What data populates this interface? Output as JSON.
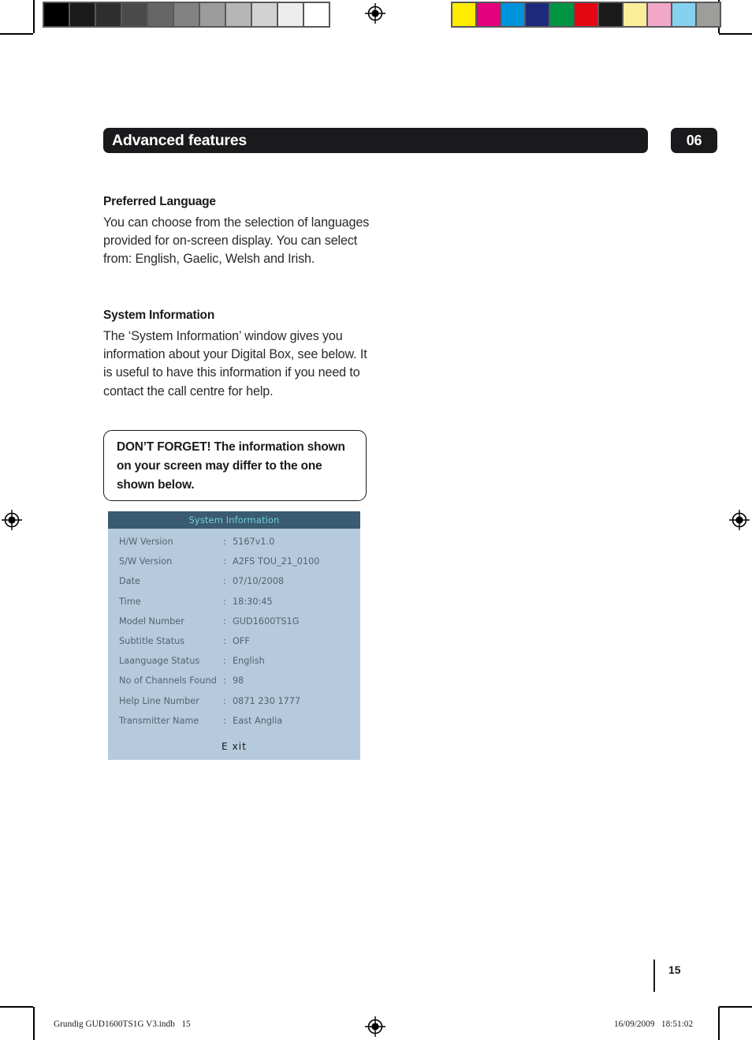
{
  "header": {
    "chapter_title": "Advanced features",
    "chapter_number": "06"
  },
  "sections": [
    {
      "heading": "Preferred Language",
      "body": "You can choose from the selection of languages provided for on-screen display. You can select from: English, Gaelic, Welsh and Irish."
    },
    {
      "heading": "System Information",
      "body": "The ‘System Information’ window gives you information about your Digital Box, see below. It is useful to have this information if you need to contact the call centre for help."
    }
  ],
  "callout": {
    "text": "DON’T FORGET! The information shown on your screen may differ to the one shown below."
  },
  "osd": {
    "title": "System Information",
    "title_color": "#71cfdd",
    "titlebar_color": "#3a5b70",
    "body_color": "#b6cadd",
    "text_color": "#55616e",
    "separator": ":",
    "rows": [
      {
        "label": "H/W Version",
        "value": "5167v1.0"
      },
      {
        "label": "S/W Version",
        "value": "A2FS TOU_21_0100"
      },
      {
        "label": "Date",
        "value": "07/10/2008"
      },
      {
        "label": "Time",
        "value": "18:30:45"
      },
      {
        "label": "Model Number",
        "value": "GUD1600TS1G"
      },
      {
        "label": "Subtitle Status",
        "value": "OFF"
      },
      {
        "label": "Laanguage Status",
        "value": "English"
      },
      {
        "label": "No of Channels Found",
        "value": "98"
      },
      {
        "label": "Help Line Number",
        "value": "0871 230 1777"
      },
      {
        "label": "Transmitter Name",
        "value": "East Anglia"
      }
    ],
    "exit_label": "E xit"
  },
  "footer": {
    "page_number": "15",
    "file_name": "Grundig GUD1600TS1G V3.indb   15",
    "timestamp": "16/09/2009   18:51:02"
  },
  "print_marks": {
    "grayscale_swatches": [
      "#000000",
      "#1a1a1a",
      "#2e2e2e",
      "#4a4a4a",
      "#666666",
      "#828282",
      "#9c9c9c",
      "#b6b6b6",
      "#d2d2d2",
      "#ededed",
      "#ffffff"
    ],
    "color_swatches": [
      "#ffec00",
      "#e4007e",
      "#0093dd",
      "#1d2a7c",
      "#009543",
      "#e30613",
      "#1a1a1a",
      "#faee9b",
      "#f0a7c8",
      "#85d1f0",
      "#9d9d9c"
    ]
  }
}
